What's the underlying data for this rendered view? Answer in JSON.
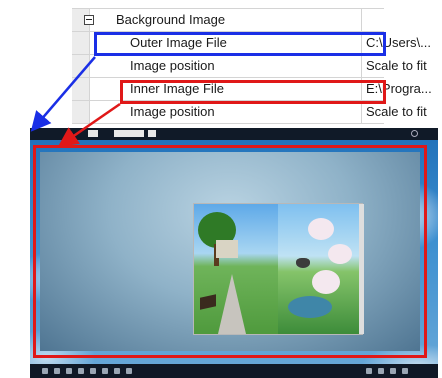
{
  "property_grid": {
    "category": "Background Image",
    "rows": [
      {
        "name": "Outer Image File",
        "value": "C:\\Users\\..."
      },
      {
        "name": "Image position",
        "value": "Scale to fit"
      },
      {
        "name": "Inner Image File",
        "value": "E:\\Progra..."
      },
      {
        "name": "Image position",
        "value": "Scale to fit"
      }
    ]
  },
  "colors": {
    "outer_highlight": "#1a2fe6",
    "inner_highlight": "#e01818"
  },
  "icons": [
    "collapse-box-icon",
    "arrow-icon"
  ]
}
